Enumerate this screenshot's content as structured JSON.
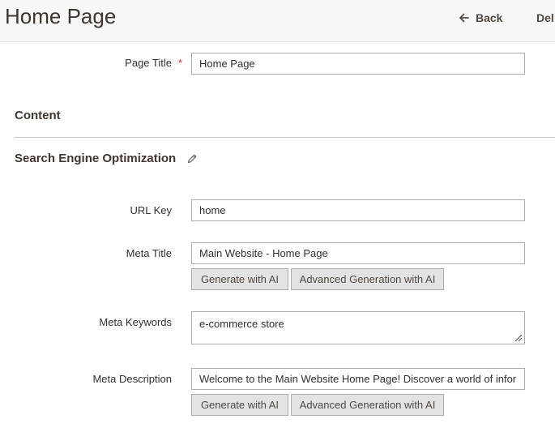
{
  "header": {
    "title": "Home Page",
    "back_label": "Back",
    "delete_label": "Del"
  },
  "form": {
    "page_title": {
      "label": "Page Title",
      "required_mark": "*",
      "value": "Home Page"
    }
  },
  "sections": {
    "content": "Content",
    "seo": "Search Engine Optimization"
  },
  "seo": {
    "url_key": {
      "label": "URL Key",
      "value": "home"
    },
    "meta_title": {
      "label": "Meta Title",
      "value": "Main Website - Home Page"
    },
    "meta_keywords": {
      "label": "Meta Keywords",
      "value": "e-commerce store"
    },
    "meta_description": {
      "label": "Meta Description",
      "value": "Welcome to the Main Website Home Page! Discover a world of information"
    },
    "generate_ai_label": "Generate with AI",
    "advanced_ai_label": "Advanced Generation with AI"
  },
  "icons": {
    "back": "arrow-left-icon",
    "edit": "pencil-icon",
    "resize": "resize-grip-icon"
  },
  "colors": {
    "required": "#e22626",
    "header_bg": "#f8f8f8",
    "button_bg": "#e3e3e3"
  }
}
